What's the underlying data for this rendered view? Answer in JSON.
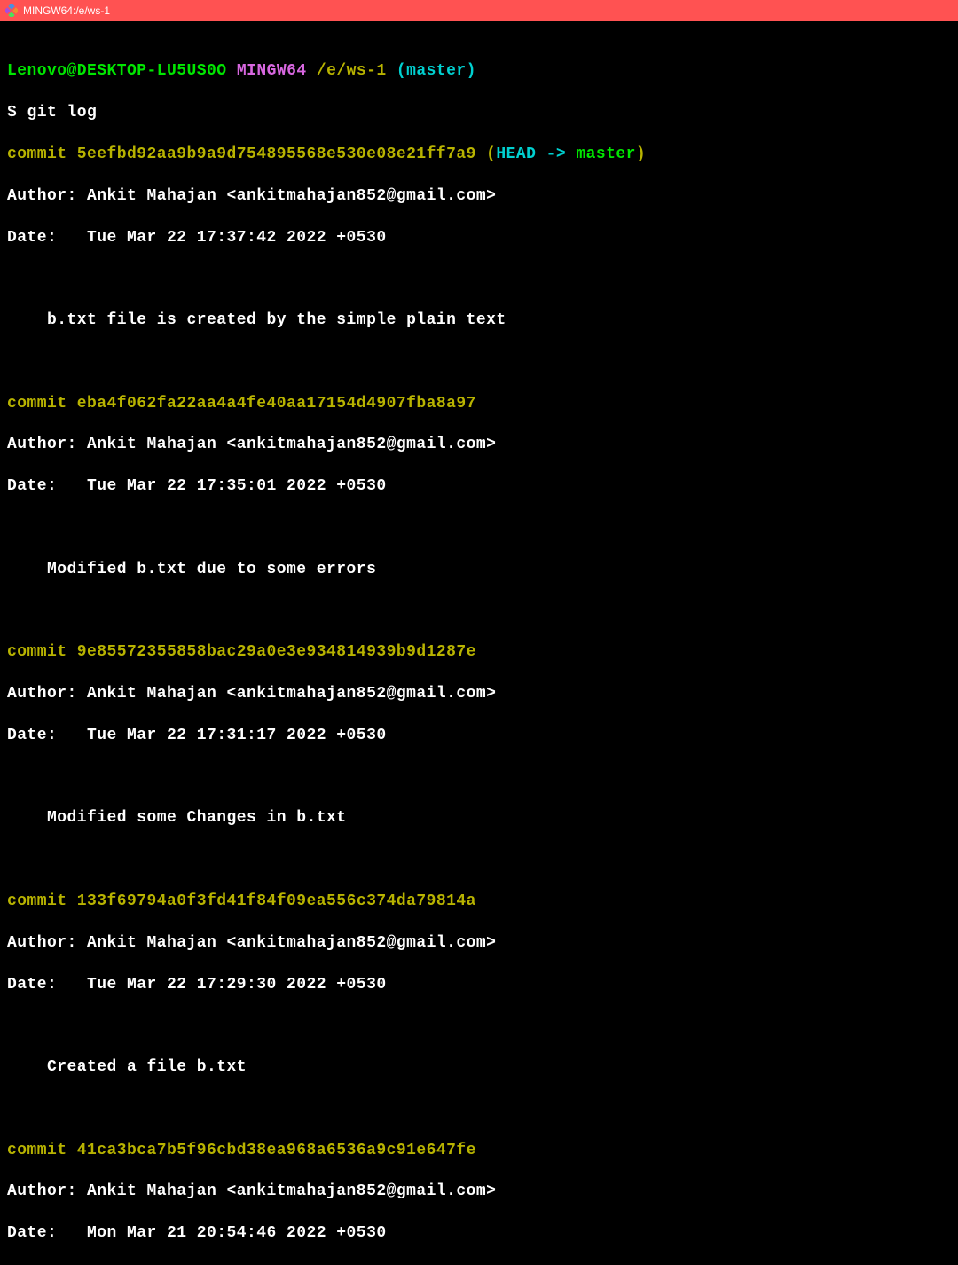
{
  "titlebar": {
    "text": "MINGW64:/e/ws-1"
  },
  "prompt": {
    "user_host": "Lenovo@DESKTOP-LU5US0O",
    "shell": "MINGW64",
    "path": "/e/ws-1",
    "branch": "(master)",
    "sigil": "$",
    "command": "git log"
  },
  "commits": [
    {
      "hash": "5eefbd92aa9b9a9d754895568e530e08e21ff7a9",
      "ref_open": "(",
      "ref_head": "HEAD -> ",
      "ref_branch": "master",
      "ref_close": ")",
      "author": "Author: Ankit Mahajan <ankitmahajan852@gmail.com>",
      "date": "Date:   Tue Mar 22 17:37:42 2022 +0530",
      "message": "    b.txt file is created by the simple plain text"
    },
    {
      "hash": "eba4f062fa22aa4a4fe40aa17154d4907fba8a97",
      "author": "Author: Ankit Mahajan <ankitmahajan852@gmail.com>",
      "date": "Date:   Tue Mar 22 17:35:01 2022 +0530",
      "message": "    Modified b.txt due to some errors"
    },
    {
      "hash": "9e85572355858bac29a0e3e934814939b9d1287e",
      "author": "Author: Ankit Mahajan <ankitmahajan852@gmail.com>",
      "date": "Date:   Tue Mar 22 17:31:17 2022 +0530",
      "message": "    Modified some Changes in b.txt"
    },
    {
      "hash": "133f69794a0f3fd41f84f09ea556c374da79814a",
      "author": "Author: Ankit Mahajan <ankitmahajan852@gmail.com>",
      "date": "Date:   Tue Mar 22 17:29:30 2022 +0530",
      "message": "    Created a file b.txt"
    },
    {
      "hash": "41ca3bca7b5f96cbd38ea968a6536a9c91e647fe",
      "author": "Author: Ankit Mahajan <ankitmahajan852@gmail.com>",
      "date": "Date:   Mon Mar 21 20:54:46 2022 +0530"
    }
  ],
  "labels": {
    "commit_word": "commit "
  }
}
